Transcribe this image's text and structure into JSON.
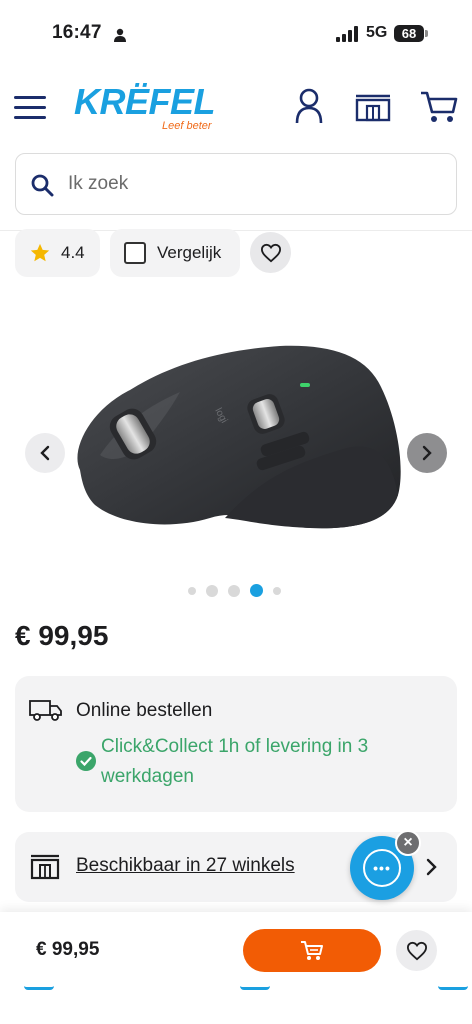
{
  "status_bar": {
    "time": "16:47",
    "network": "5G",
    "battery": "68"
  },
  "header": {
    "logo_text": "KRËFEL",
    "logo_tagline": "Leef beter",
    "icons": [
      "menu-icon",
      "account-icon",
      "store-icon",
      "cart-icon"
    ]
  },
  "search": {
    "placeholder": "Ik zoek"
  },
  "product": {
    "rating": "4.4",
    "compare_label": "Vergelijk",
    "image_dots": {
      "count": 5,
      "active_index": 3
    },
    "price": "€ 99,95"
  },
  "delivery": {
    "online_label": "Online bestellen",
    "clickcollect_text": "Click&Collect 1h of levering in 3 werkdagen"
  },
  "stores": {
    "label": "Beschikbaar in 27 winkels"
  },
  "bottom_bar": {
    "price": "€ 99,95"
  },
  "colors": {
    "brand_blue": "#1aa0e0",
    "nav_blue": "#1b2d6b",
    "accent_orange": "#f25c05",
    "success_green": "#3ba56a",
    "chat_blue": "#1b9fe2"
  }
}
